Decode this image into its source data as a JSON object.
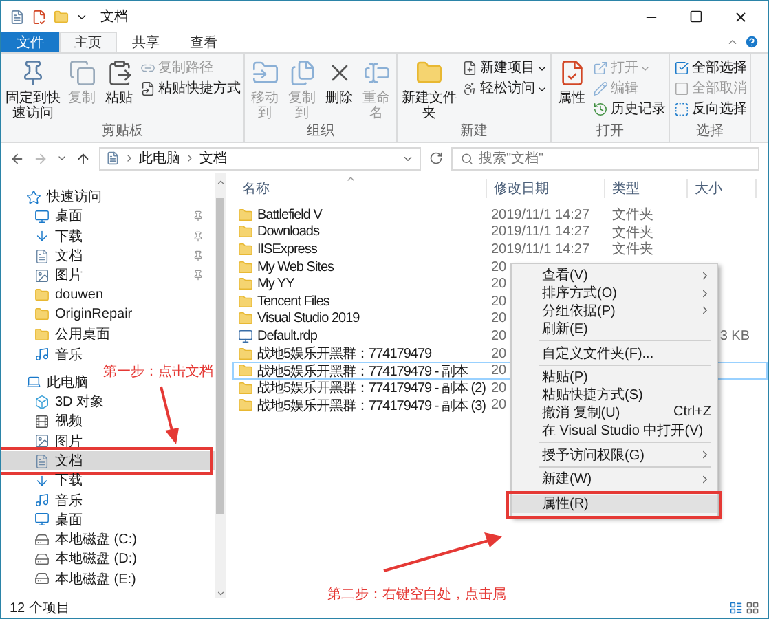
{
  "window": {
    "title": "文档"
  },
  "ribbon_tabs": [
    {
      "label": "文件",
      "kind": "file",
      "selected": false
    },
    {
      "label": "主页",
      "kind": "tab",
      "selected": true
    },
    {
      "label": "共享",
      "kind": "tab",
      "selected": false
    },
    {
      "label": "查看",
      "kind": "tab",
      "selected": false
    }
  ],
  "ribbon_groups": [
    {
      "label": "剪贴板",
      "items": [
        {
          "kind": "large",
          "label": "固定到快速访问",
          "disabled": false
        },
        {
          "kind": "large",
          "label": "复制",
          "disabled": true
        },
        {
          "kind": "large",
          "label": "粘贴",
          "disabled": false
        },
        {
          "kind": "stack",
          "buttons": [
            {
              "label": "复制路径",
              "disabled": true,
              "dropdown": false
            },
            {
              "label": "粘贴快捷方式",
              "disabled": false,
              "dropdown": false
            }
          ]
        }
      ]
    },
    {
      "label": "组织",
      "items": [
        {
          "kind": "large",
          "label": "移动到",
          "disabled": true
        },
        {
          "kind": "large",
          "label": "复制到",
          "disabled": true
        },
        {
          "kind": "large",
          "label": "删除",
          "disabled": false
        },
        {
          "kind": "large",
          "label": "重命名",
          "disabled": true
        }
      ]
    },
    {
      "label": "新建",
      "items": [
        {
          "kind": "large",
          "label": "新建文件夹",
          "disabled": false
        },
        {
          "kind": "stack",
          "buttons": [
            {
              "label": "新建项目",
              "disabled": false,
              "dropdown": true
            },
            {
              "label": "轻松访问",
              "disabled": false,
              "dropdown": true
            }
          ]
        }
      ]
    },
    {
      "label": "打开",
      "items": [
        {
          "kind": "large",
          "label": "属性",
          "disabled": false
        },
        {
          "kind": "stack",
          "buttons": [
            {
              "label": "打开",
              "disabled": true,
              "dropdown": true
            },
            {
              "label": "编辑",
              "disabled": true,
              "dropdown": false
            },
            {
              "label": "历史记录",
              "disabled": false,
              "dropdown": false
            }
          ]
        }
      ]
    },
    {
      "label": "选择",
      "items": [
        {
          "kind": "stack",
          "buttons": [
            {
              "label": "全部选择",
              "disabled": false,
              "dropdown": false
            },
            {
              "label": "全部取消",
              "disabled": true,
              "dropdown": false
            },
            {
              "label": "反向选择",
              "disabled": false,
              "dropdown": false
            }
          ]
        }
      ]
    }
  ],
  "address": {
    "path": [
      "此电脑",
      "文档"
    ],
    "search_placeholder": "搜索\"文档\""
  },
  "navigation": [
    {
      "label": "快速访问",
      "kind": "star",
      "selected": false,
      "children": [
        {
          "label": "桌面",
          "kind": "desktop",
          "selected": false,
          "pinned": true
        },
        {
          "label": "下载",
          "kind": "download",
          "selected": false,
          "pinned": true
        },
        {
          "label": "文档",
          "kind": "doc",
          "selected": false,
          "pinned": true
        },
        {
          "label": "图片",
          "kind": "pictures",
          "selected": false,
          "pinned": true
        },
        {
          "label": "douwen",
          "kind": "folder",
          "selected": false,
          "pinned": false
        },
        {
          "label": "OriginRepair",
          "kind": "folder",
          "selected": false,
          "pinned": false
        },
        {
          "label": "公用桌面",
          "kind": "folder",
          "selected": false,
          "pinned": false
        },
        {
          "label": "音乐",
          "kind": "music",
          "selected": false,
          "pinned": false
        }
      ]
    },
    {
      "label": "此电脑",
      "kind": "pc",
      "selected": false,
      "children": [
        {
          "label": "3D 对象",
          "kind": "cube",
          "selected": false,
          "pinned": false
        },
        {
          "label": "视频",
          "kind": "video",
          "selected": false,
          "pinned": false
        },
        {
          "label": "图片",
          "kind": "pictures",
          "selected": false,
          "pinned": false
        },
        {
          "label": "文档",
          "kind": "doc",
          "selected": true,
          "pinned": false
        },
        {
          "label": "下载",
          "kind": "download",
          "selected": false,
          "pinned": false
        },
        {
          "label": "音乐",
          "kind": "music",
          "selected": false,
          "pinned": false
        },
        {
          "label": "桌面",
          "kind": "desktop",
          "selected": false,
          "pinned": false
        },
        {
          "label": "本地磁盘 (C:)",
          "kind": "drive",
          "selected": false,
          "pinned": false
        },
        {
          "label": "本地磁盘 (D:)",
          "kind": "drive",
          "selected": false,
          "pinned": false
        },
        {
          "label": "本地磁盘 (E:)",
          "kind": "drive",
          "selected": false,
          "pinned": false
        }
      ]
    }
  ],
  "table": {
    "columns": [
      "名称",
      "修改日期",
      "类型",
      "大小"
    ],
    "rows": [
      {
        "name": "Battlefield V",
        "kind": "folder",
        "date": "2019/11/1 14:27",
        "type": "文件夹",
        "focused": false
      },
      {
        "name": "Downloads",
        "kind": "folder",
        "date": "2019/11/1 14:27",
        "type": "文件夹",
        "focused": false
      },
      {
        "name": "IISExpress",
        "kind": "folder",
        "date": "2019/11/1 14:27",
        "type": "文件夹",
        "focused": false
      },
      {
        "name": "My Web Sites",
        "kind": "folder",
        "date": "20",
        "focused": false
      },
      {
        "name": "My YY",
        "kind": "folder",
        "date": "20",
        "focused": false
      },
      {
        "name": "Tencent Files",
        "kind": "folder",
        "date": "20",
        "focused": false
      },
      {
        "name": "Visual Studio 2019",
        "kind": "folder",
        "date": "20",
        "focused": false
      },
      {
        "name": "Default.rdp",
        "kind": "rdp",
        "date": "20",
        "size": "3 KB",
        "focused": false
      },
      {
        "name": "战地5娱乐开黑群：774179479",
        "kind": "folder",
        "date": "20",
        "focused": false
      },
      {
        "name": "战地5娱乐开黑群：774179479 - 副本",
        "kind": "folder",
        "date": "20",
        "focused": true
      },
      {
        "name": "战地5娱乐开黑群：774179479 - 副本 (2)",
        "kind": "folder",
        "date": "20",
        "focused": false
      },
      {
        "name": "战地5娱乐开黑群：774179479 - 副本 (3)",
        "kind": "folder",
        "date": "20",
        "focused": false
      }
    ]
  },
  "context_menu": [
    {
      "kind": "item",
      "label": "查看(V)",
      "submenu": true,
      "highlighted": false
    },
    {
      "kind": "item",
      "label": "排序方式(O)",
      "submenu": true,
      "highlighted": false
    },
    {
      "kind": "item",
      "label": "分组依据(P)",
      "submenu": true,
      "highlighted": false
    },
    {
      "kind": "item",
      "label": "刷新(E)",
      "submenu": false,
      "highlighted": false
    },
    {
      "kind": "separator"
    },
    {
      "kind": "item",
      "label": "自定义文件夹(F)...",
      "submenu": false,
      "highlighted": false
    },
    {
      "kind": "separator"
    },
    {
      "kind": "item",
      "label": "粘贴(P)",
      "submenu": false,
      "highlighted": false
    },
    {
      "kind": "item",
      "label": "粘贴快捷方式(S)",
      "submenu": false,
      "highlighted": false
    },
    {
      "kind": "item",
      "label": "撤消 复制(U)",
      "shortcut": "Ctrl+Z",
      "submenu": false,
      "highlighted": false
    },
    {
      "kind": "item",
      "label": "在 Visual Studio 中打开(V)",
      "submenu": false,
      "highlighted": false
    },
    {
      "kind": "separator"
    },
    {
      "kind": "item",
      "label": "授予访问权限(G)",
      "submenu": true,
      "highlighted": false
    },
    {
      "kind": "separator"
    },
    {
      "kind": "item",
      "label": "新建(W)",
      "submenu": true,
      "highlighted": false
    },
    {
      "kind": "separator"
    },
    {
      "kind": "item",
      "label": "属性(R)",
      "submenu": false,
      "highlighted": true
    }
  ],
  "status_bar": {
    "count": "12 个项目"
  },
  "annotations": [
    {
      "text": "第一步：点击文档"
    },
    {
      "text": "第二步：右键空白处，点击属"
    }
  ]
}
